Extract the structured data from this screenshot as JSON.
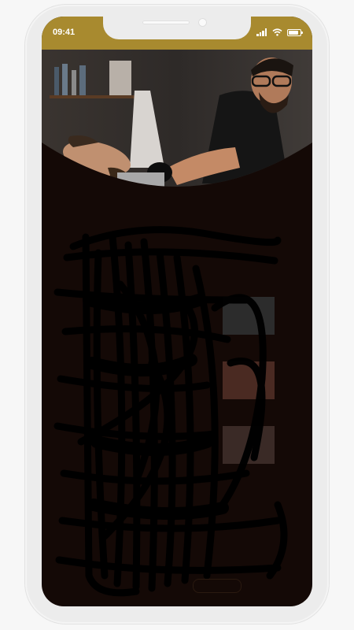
{
  "status_bar": {
    "time": "09:41",
    "bar_color": "#a88a2f",
    "icons": [
      "signal-icon",
      "wifi-icon",
      "battery-icon"
    ],
    "battery_level": 0.85
  },
  "screen": {
    "background": "#140906",
    "hero_image": "barber-grooming-beard-photo"
  },
  "content": {
    "obscured": true
  }
}
